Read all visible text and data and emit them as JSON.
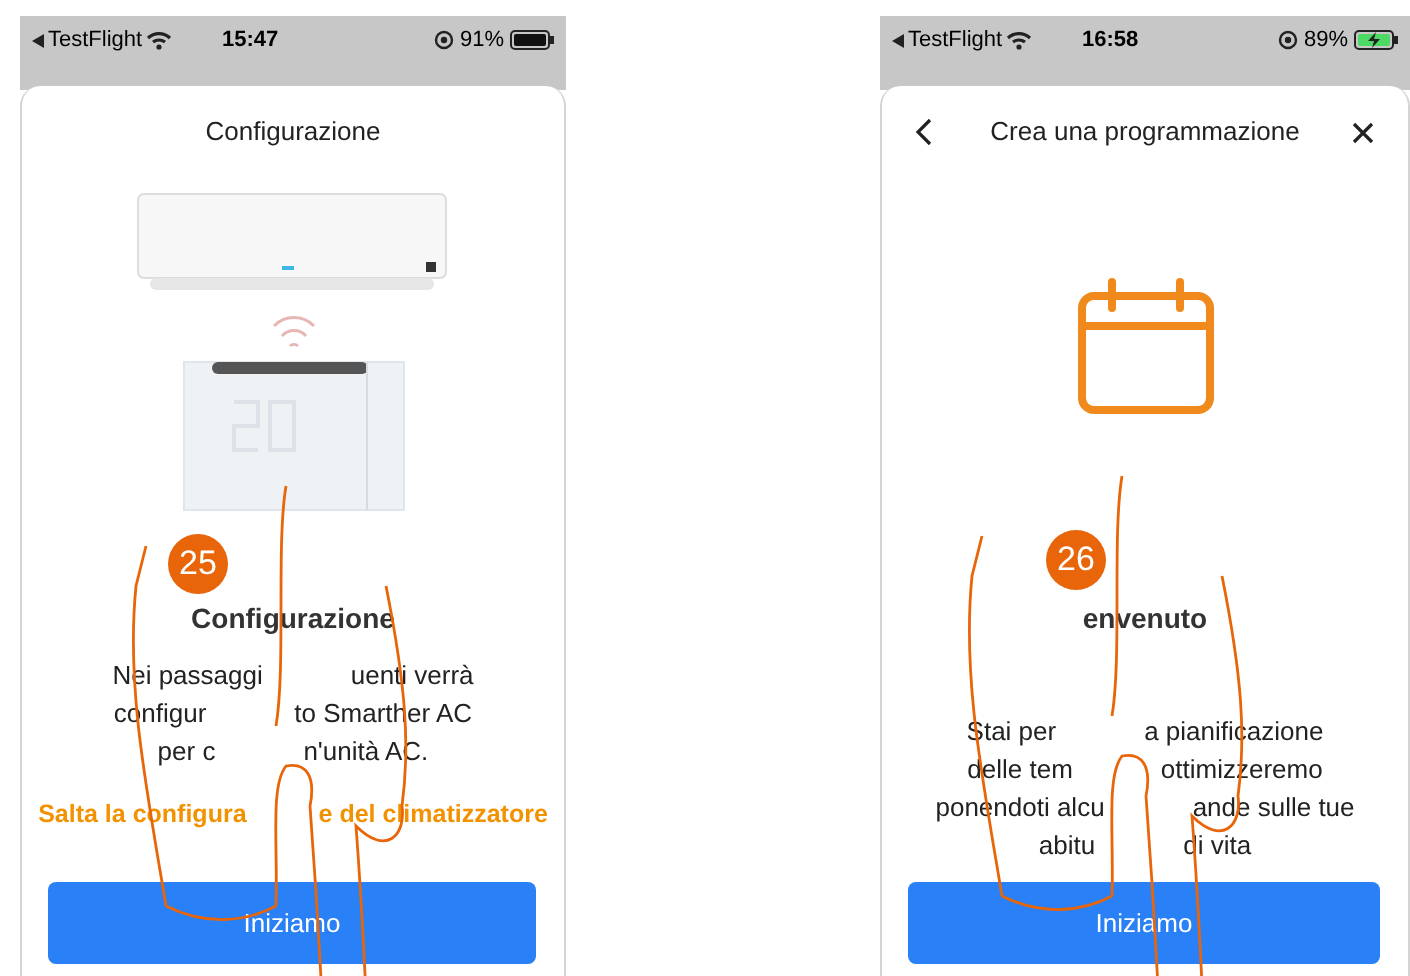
{
  "screens": [
    {
      "status_bar": {
        "app": "TestFlight",
        "time": "15:47",
        "battery": "91%",
        "charging": false
      },
      "header": {
        "title": "Configurazione",
        "back": false,
        "close": false
      },
      "kind": "configuration",
      "step_badge": "25",
      "heading": "Configurazione",
      "body_lines": [
        {
          "parts": [
            "Nei passaggi",
            "uenti verrà"
          ]
        },
        {
          "parts": [
            "configur",
            "to Smarther AC"
          ]
        },
        {
          "parts": [
            "per c",
            "n'unità AC."
          ]
        }
      ],
      "link_parts": [
        "Salta la configura",
        "e del climatizzatore"
      ],
      "button": {
        "label": "Iniziamo"
      }
    },
    {
      "status_bar": {
        "app": "TestFlight",
        "time": "16:58",
        "battery": "89%",
        "charging": true
      },
      "header": {
        "title": "Crea una programmazione",
        "back": true,
        "close": true
      },
      "kind": "schedule",
      "step_badge": "26",
      "heading": "envenuto",
      "body_lines": [
        {
          "parts": [
            "Stai per",
            "a pianificazione"
          ]
        },
        {
          "parts": [
            "delle tem",
            "ottimizzeremo"
          ]
        },
        {
          "parts": [
            "ponendoti alcu",
            "ande sulle tue"
          ]
        },
        {
          "parts": [
            "abitu",
            "di vita"
          ]
        }
      ],
      "button": {
        "label": "Iniziamo"
      }
    }
  ]
}
